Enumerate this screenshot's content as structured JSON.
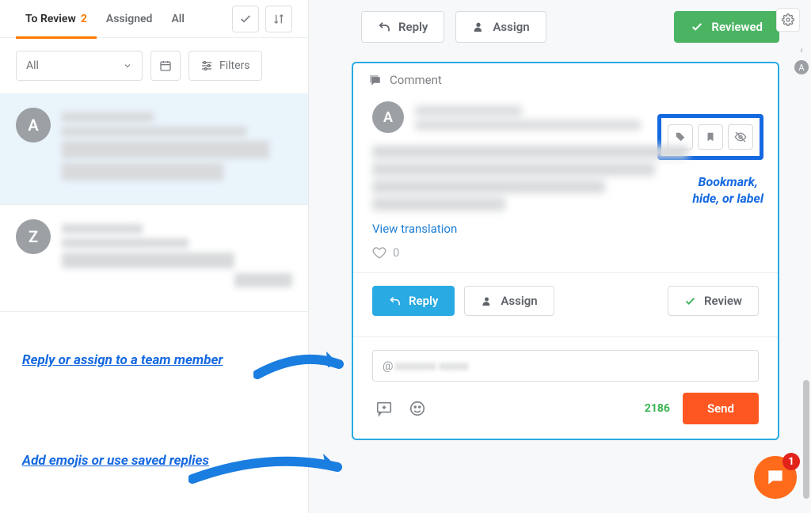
{
  "tabs": {
    "to_review": "To Review",
    "to_review_count": "2",
    "assigned": "Assigned",
    "all": "All"
  },
  "filters": {
    "all": "All",
    "filters_btn": "Filters"
  },
  "list": {
    "item0_avatar": "A",
    "item1_avatar": "Z"
  },
  "topbar": {
    "reply": "Reply",
    "assign": "Assign",
    "reviewed": "Reviewed"
  },
  "comment": {
    "header": "Comment",
    "avatar": "A",
    "translation": "View translation",
    "likes": "0"
  },
  "actions": {
    "reply": "Reply",
    "assign": "Assign",
    "review": "Review"
  },
  "annotations": {
    "bookmark_line1": "Bookmark,",
    "bookmark_line2": "hide, or label",
    "reply_assign": "Reply or assign to a team member",
    "emoji_saved": "Add emojis or use saved replies"
  },
  "reply_box": {
    "prefix": "@",
    "char_count": "2186",
    "send": "Send"
  },
  "chat": {
    "badge": "1"
  }
}
